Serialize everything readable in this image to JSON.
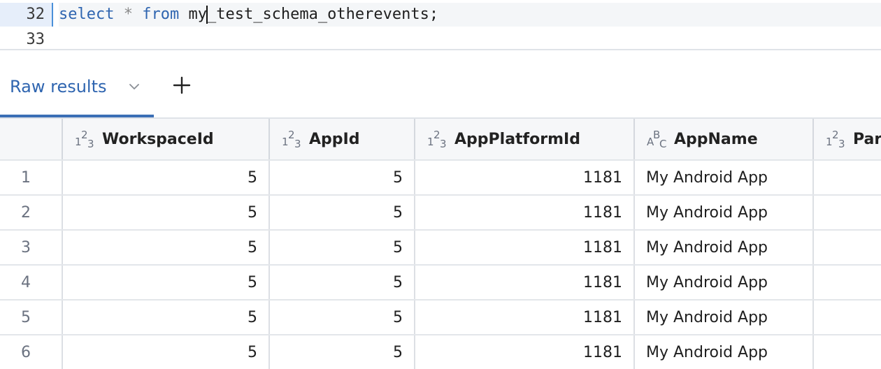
{
  "editor": {
    "lines": [
      {
        "number": "32",
        "kw1": "select",
        "op": "*",
        "kw2": "from",
        "ident_before_caret": "my",
        "ident_after_caret": "_test_schema_otherevents;"
      },
      {
        "number": "33"
      }
    ]
  },
  "tabs": {
    "active_label": "Raw results"
  },
  "grid": {
    "columns": [
      {
        "name": "WorkspaceId",
        "type": "number"
      },
      {
        "name": "AppId",
        "type": "number"
      },
      {
        "name": "AppPlatformId",
        "type": "number"
      },
      {
        "name": "AppName",
        "type": "text"
      },
      {
        "name": "Par",
        "type": "number"
      }
    ],
    "rows": [
      {
        "n": "1",
        "workspace": "5",
        "app": "5",
        "platform": "1181",
        "name": "My Android App"
      },
      {
        "n": "2",
        "workspace": "5",
        "app": "5",
        "platform": "1181",
        "name": "My Android App"
      },
      {
        "n": "3",
        "workspace": "5",
        "app": "5",
        "platform": "1181",
        "name": "My Android App"
      },
      {
        "n": "4",
        "workspace": "5",
        "app": "5",
        "platform": "1181",
        "name": "My Android App"
      },
      {
        "n": "5",
        "workspace": "5",
        "app": "5",
        "platform": "1181",
        "name": "My Android App"
      },
      {
        "n": "6",
        "workspace": "5",
        "app": "5",
        "platform": "1181",
        "name": "My Android App"
      }
    ]
  },
  "icons": {
    "chevron": "chevron-down-icon",
    "plus": "plus-icon",
    "number_type": "numeric-type-icon",
    "text_type": "text-type-icon"
  },
  "colors": {
    "accent": "#3b6fb6",
    "keyword": "#2f65b0"
  }
}
